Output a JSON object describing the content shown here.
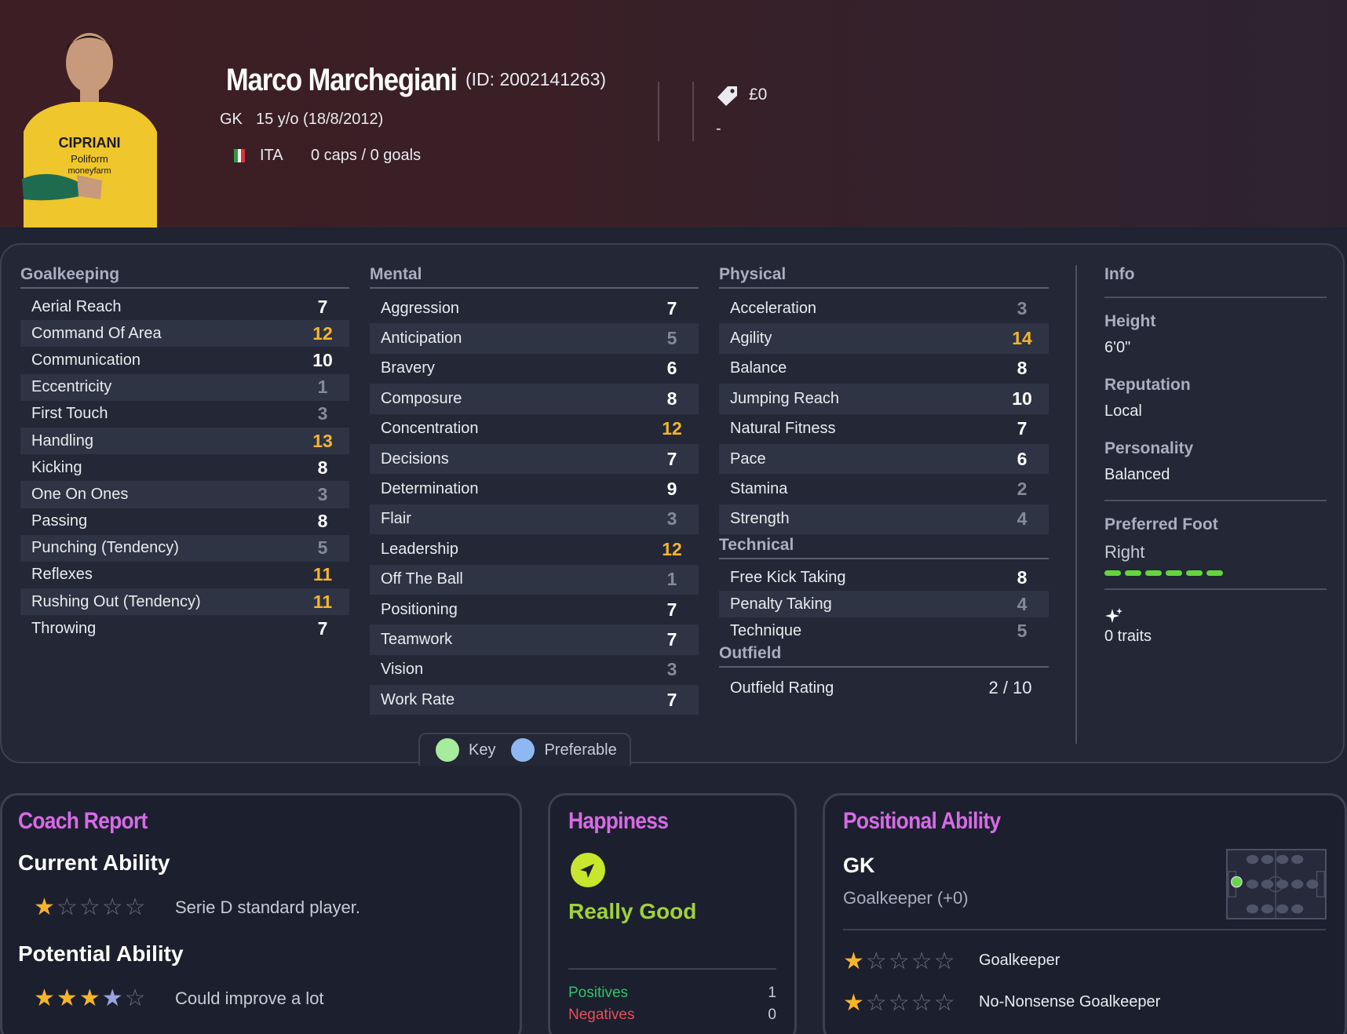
{
  "player": {
    "name": "Marco Marchegiani",
    "id_text": "(ID: 2002141263)",
    "position": "GK",
    "age_text": "15 y/o (18/8/2012)",
    "nationality": "ITA",
    "caps_text": "0 caps / 0 goals",
    "value": "£0",
    "value_sub": "-"
  },
  "goalkeeping": {
    "title": "Goalkeeping",
    "rows": [
      {
        "label": "Aerial Reach",
        "value": "7"
      },
      {
        "label": "Command Of Area",
        "value": "12"
      },
      {
        "label": "Communication",
        "value": "10"
      },
      {
        "label": "Eccentricity",
        "value": "1"
      },
      {
        "label": "First Touch",
        "value": "3"
      },
      {
        "label": "Handling",
        "value": "13"
      },
      {
        "label": "Kicking",
        "value": "8"
      },
      {
        "label": "One On Ones",
        "value": "3"
      },
      {
        "label": "Passing",
        "value": "8"
      },
      {
        "label": "Punching (Tendency)",
        "value": "5"
      },
      {
        "label": "Reflexes",
        "value": "11"
      },
      {
        "label": "Rushing Out (Tendency)",
        "value": "11"
      },
      {
        "label": "Throwing",
        "value": "7"
      }
    ]
  },
  "mental": {
    "title": "Mental",
    "rows": [
      {
        "label": "Aggression",
        "value": "7"
      },
      {
        "label": "Anticipation",
        "value": "5"
      },
      {
        "label": "Bravery",
        "value": "6"
      },
      {
        "label": "Composure",
        "value": "8"
      },
      {
        "label": "Concentration",
        "value": "12"
      },
      {
        "label": "Decisions",
        "value": "7"
      },
      {
        "label": "Determination",
        "value": "9"
      },
      {
        "label": "Flair",
        "value": "3"
      },
      {
        "label": "Leadership",
        "value": "12"
      },
      {
        "label": "Off The Ball",
        "value": "1"
      },
      {
        "label": "Positioning",
        "value": "7"
      },
      {
        "label": "Teamwork",
        "value": "7"
      },
      {
        "label": "Vision",
        "value": "3"
      },
      {
        "label": "Work Rate",
        "value": "7"
      }
    ]
  },
  "physical": {
    "title": "Physical",
    "rows": [
      {
        "label": "Acceleration",
        "value": "3"
      },
      {
        "label": "Agility",
        "value": "14"
      },
      {
        "label": "Balance",
        "value": "8"
      },
      {
        "label": "Jumping Reach",
        "value": "10"
      },
      {
        "label": "Natural Fitness",
        "value": "7"
      },
      {
        "label": "Pace",
        "value": "6"
      },
      {
        "label": "Stamina",
        "value": "2"
      },
      {
        "label": "Strength",
        "value": "4"
      }
    ]
  },
  "technical": {
    "title": "Technical",
    "rows": [
      {
        "label": "Free Kick Taking",
        "value": "8"
      },
      {
        "label": "Penalty Taking",
        "value": "4"
      },
      {
        "label": "Technique",
        "value": "5"
      }
    ]
  },
  "outfield": {
    "title": "Outfield",
    "label": "Outfield Rating",
    "value": "2 / 10"
  },
  "info": {
    "title": "Info",
    "height_label": "Height",
    "height": "6'0\"",
    "reputation_label": "Reputation",
    "reputation": "Local",
    "personality_label": "Personality",
    "personality": "Balanced",
    "foot_label": "Preferred Foot",
    "foot": "Right",
    "traits": "0 traits"
  },
  "legend": {
    "key": "Key",
    "preferable": "Preferable",
    "key_color": "#a7eb9c",
    "preferable_color": "#8fb8f2"
  },
  "coach": {
    "title": "Coach Report",
    "ca_label": "Current Ability",
    "ca_stars": 1,
    "ca_text": "Serie D standard player.",
    "pa_label": "Potential Ability",
    "pa_stars": 3.5,
    "pa_text": "Could improve a lot"
  },
  "happiness": {
    "title": "Happiness",
    "status": "Really Good",
    "positives_label": "Positives",
    "positives": "1",
    "negatives_label": "Negatives",
    "negatives": "0"
  },
  "positional": {
    "title": "Positional Ability",
    "position": "GK",
    "position_full": "Goalkeeper (+0)",
    "roles": [
      {
        "name": "Goalkeeper",
        "stars": 1
      },
      {
        "name": "No-Nonsense Goalkeeper",
        "stars": 1
      }
    ]
  },
  "colors": {
    "accent_good": "#f5b52b",
    "title_pink": "#d66be6",
    "happy_green": "#9fd23a",
    "positive": "#2fc46b",
    "negative": "#e5505b"
  }
}
